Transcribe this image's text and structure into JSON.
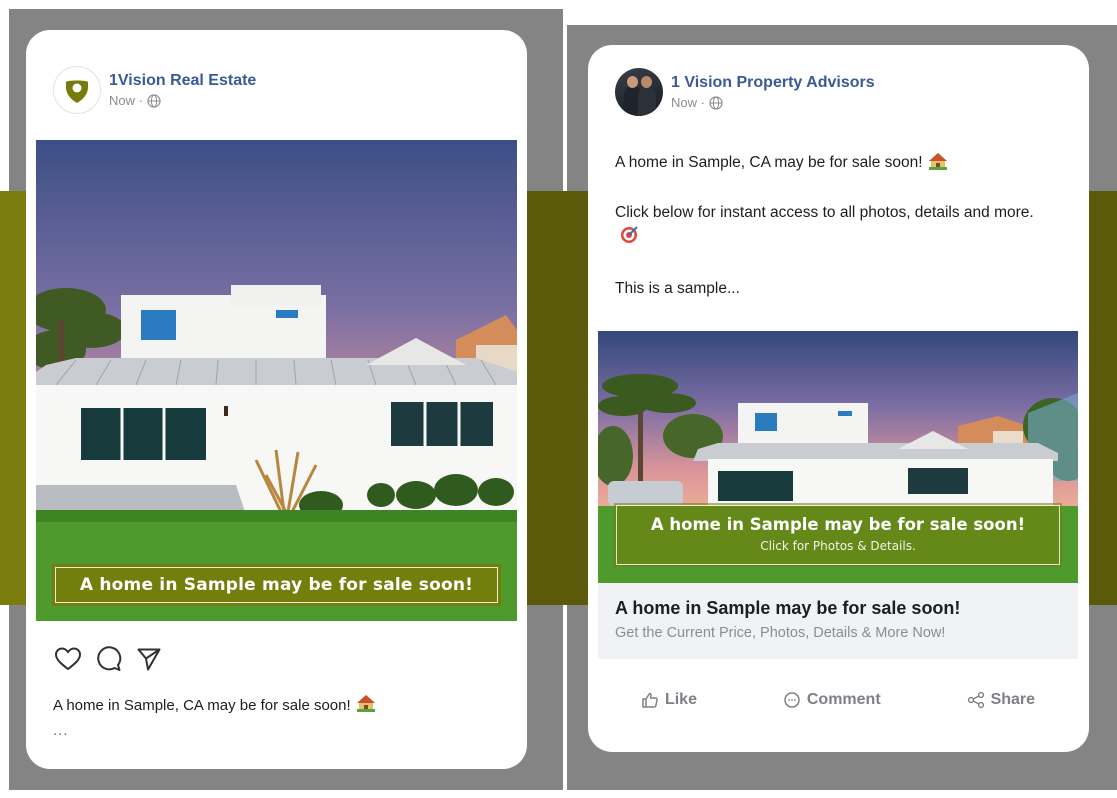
{
  "colors": {
    "brand_olive": "#767c0a",
    "band_dark": "#5a5a0a",
    "background_gray": "#848484",
    "link_blue": "#3b5998",
    "muted_text": "#8a8d91"
  },
  "instagram_post": {
    "page_name": "1Vision Real Estate",
    "timestamp": "Now ·",
    "avatar_icon": "map-pin-shield-logo",
    "photo_banner": "A home in Sample may be for sale soon!",
    "actions": [
      "heart-icon",
      "comment-icon",
      "share-send-icon"
    ],
    "caption": "A home in Sample, CA may be for sale soon!",
    "more": "..."
  },
  "facebook_post": {
    "page_name": "1 Vision Property Advisors",
    "timestamp": "Now ·",
    "body_line1": "A home in Sample, CA may be for sale soon!",
    "body_line2": "Click below for instant access to all photos, details and more.",
    "body_line3": "This is a sample...",
    "photo_overlay_title": "A home in Sample may be for sale soon!",
    "photo_overlay_sub": "Click for Photos & Details.",
    "link_title": "A home in Sample may be for sale soon!",
    "link_subtitle": "Get the Current Price, Photos, Details & More Now!",
    "actions": {
      "like": "Like",
      "comment": "Comment",
      "share": "Share"
    }
  }
}
